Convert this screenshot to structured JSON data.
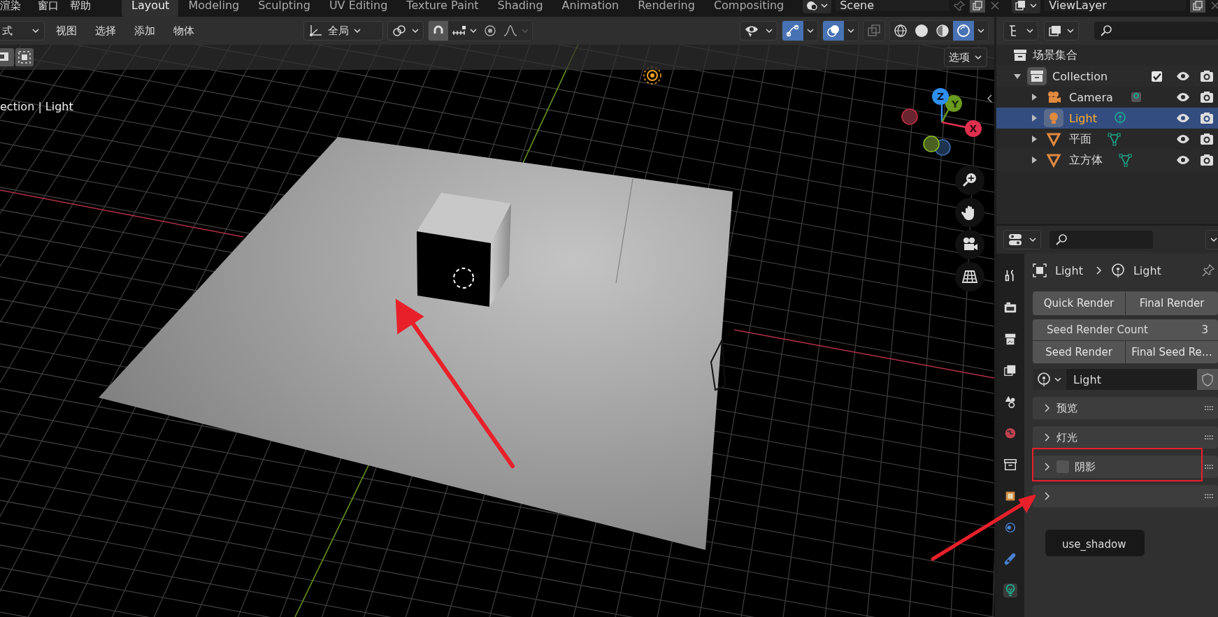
{
  "top_menu": [
    "渲染",
    "窗口",
    "帮助"
  ],
  "workspaces": [
    {
      "label": "Layout",
      "selected": true
    },
    {
      "label": "Modeling",
      "selected": false
    },
    {
      "label": "Sculpting",
      "selected": false
    },
    {
      "label": "UV Editing",
      "selected": false
    },
    {
      "label": "Texture Paint",
      "selected": false
    },
    {
      "label": "Shading",
      "selected": false
    },
    {
      "label": "Animation",
      "selected": false
    },
    {
      "label": "Rendering",
      "selected": false
    },
    {
      "label": "Compositing",
      "selected": false
    }
  ],
  "scene": {
    "value": "Scene"
  },
  "view_layer": {
    "value": "ViewLayer"
  },
  "viewport": {
    "mode": "式",
    "menus": [
      "视图",
      "选择",
      "添加",
      "物体"
    ],
    "orientation": "全局",
    "options": "选项",
    "info": "ection | Light",
    "toggles": [
      {
        "kind": "snap",
        "on": true
      },
      {
        "kind": "proportional",
        "on": false
      },
      {
        "kind": "gizmo",
        "on": true
      },
      {
        "kind": "overlay",
        "on": true
      },
      {
        "kind": "xray",
        "on": false
      }
    ],
    "shading_modes": [
      {
        "kind": "wire",
        "selected": false
      },
      {
        "kind": "solid",
        "selected": false
      },
      {
        "kind": "material",
        "selected": false
      },
      {
        "kind": "rendered",
        "selected": true
      }
    ],
    "gizmo": {
      "x": "X",
      "y": "Y",
      "z": "Z"
    }
  },
  "outliner": {
    "root": "场景集合",
    "collection": {
      "name": "Collection",
      "expanded": true,
      "checked": true,
      "children": [
        {
          "name": "Camera",
          "kind": "camera",
          "selected": false
        },
        {
          "name": "Light",
          "kind": "light",
          "selected": true
        },
        {
          "name": "平面",
          "kind": "mesh",
          "selected": false
        },
        {
          "name": "立方体",
          "kind": "mesh",
          "selected": false
        }
      ]
    }
  },
  "properties": {
    "breadcrumb": [
      "Light",
      "Light"
    ],
    "buttons": [
      "Quick Render",
      "Final Render"
    ],
    "count_field": {
      "label": "Seed Render Count",
      "value": "3"
    },
    "seed_buttons": [
      "Seed Render",
      "Final Seed Re…"
    ],
    "datablock": "Light",
    "panels": [
      {
        "label": "预览",
        "expanded": false,
        "kind": "plain"
      },
      {
        "label": "灯光",
        "expanded": false,
        "kind": "plain"
      },
      {
        "label": "阴影",
        "expanded": false,
        "kind": "checkbox",
        "checked": false
      },
      {
        "expanded": false,
        "kind": "plain"
      }
    ],
    "tooltip": "use_shadow",
    "tabs": [
      {
        "kind": "tool",
        "selected": false
      },
      {
        "kind": "render",
        "selected": false
      },
      {
        "kind": "output",
        "selected": false
      },
      {
        "kind": "view_layer",
        "selected": false
      },
      {
        "kind": "scene",
        "selected": false
      },
      {
        "kind": "world",
        "selected": false
      },
      {
        "kind": "collection",
        "selected": false
      },
      {
        "kind": "object",
        "selected": false
      },
      {
        "kind": "physics",
        "selected": false
      },
      {
        "kind": "constraint",
        "selected": false
      },
      {
        "kind": "light_data",
        "selected": true
      }
    ]
  }
}
